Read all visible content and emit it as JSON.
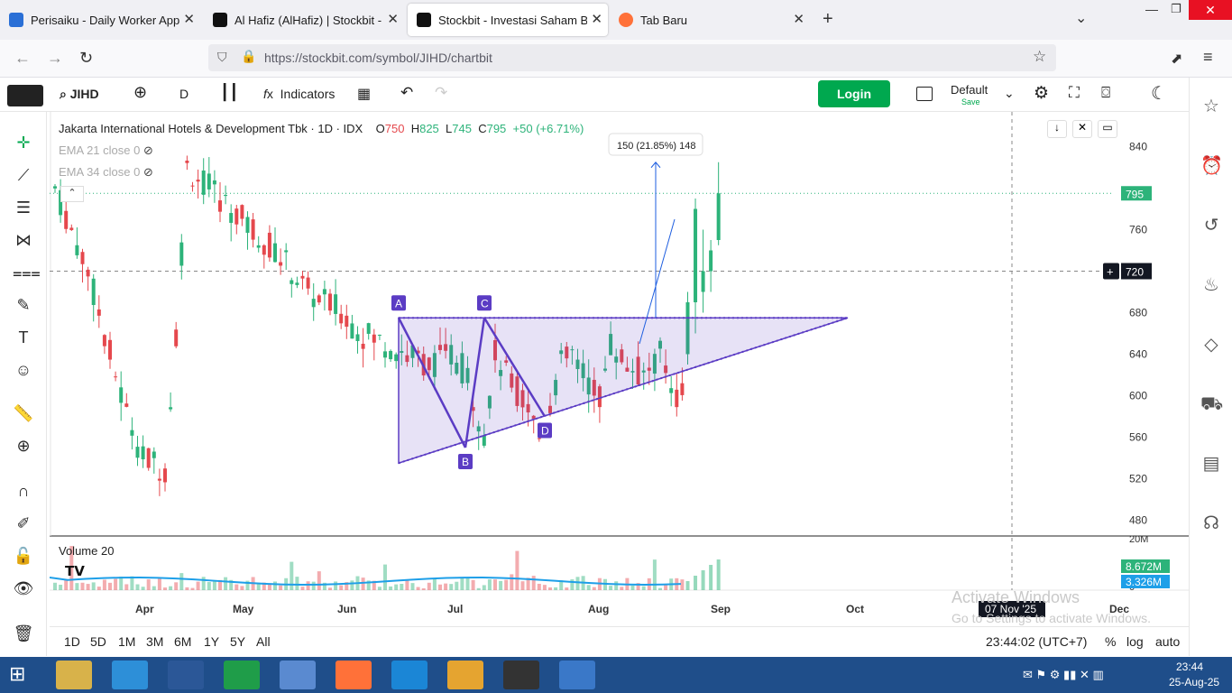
{
  "browser": {
    "tabs": [
      {
        "title": "Perisaiku - Daily Worker App",
        "active": false
      },
      {
        "title": "Al Hafiz (AlHafiz) | Stockbit - Inv",
        "active": false
      },
      {
        "title": "Stockbit - Investasi Saham Bersa",
        "active": true
      },
      {
        "title": "Tab Baru",
        "active": false
      }
    ],
    "new_tab": "+",
    "url": "https://stockbit.com/symbol/JIHD/chartbit"
  },
  "toolbar": {
    "symbol": "JIHD",
    "interval": "D",
    "indicators_label": "Indicators",
    "login_label": "Login",
    "layout_name": "Default",
    "layout_save": "Save"
  },
  "chart": {
    "title": "Jakarta International Hotels & Development Tbk · 1D · IDX",
    "ohlc": {
      "o_label": "O",
      "o": "750",
      "h_label": "H",
      "h": "825",
      "l_label": "L",
      "l": "745",
      "c_label": "C",
      "c": "795",
      "change": "+50 (+6.71%)"
    },
    "ema1": "EMA 21 close 0",
    "ema2": "EMA 34 close 0",
    "volume_label": "Volume 20",
    "measure_label": "150 (21.85%) 148",
    "last_price": "795",
    "crosshair_price": "720",
    "crosshair_date": "07 Nov '25",
    "price_ticks": [
      "840",
      "760",
      "680",
      "640",
      "600",
      "560",
      "520",
      "480"
    ],
    "volume_ticks": [
      "20M",
      "0"
    ],
    "volume_badges": [
      "8.672M",
      "3.326M"
    ],
    "months": [
      "Apr",
      "May",
      "Jun",
      "Jul",
      "Aug",
      "Sep",
      "Oct",
      "Dec"
    ],
    "points": [
      "A",
      "B",
      "C",
      "D"
    ]
  },
  "chart_data": {
    "type": "candlestick",
    "title": "Jakarta International Hotels & Development Tbk · 1D · IDX",
    "ylim": [
      470,
      870
    ],
    "y_ticks": [
      480,
      520,
      560,
      600,
      640,
      680,
      760,
      840
    ],
    "last": {
      "open": 750,
      "high": 825,
      "low": 745,
      "close": 795
    },
    "pattern_points": [
      {
        "label": "A",
        "price": 675
      },
      {
        "label": "B",
        "price": 550
      },
      {
        "label": "C",
        "price": 675
      },
      {
        "label": "D",
        "price": 580
      }
    ],
    "up_color": "#2db37a",
    "down_color": "#e5484d"
  },
  "bottom": {
    "ranges": [
      "1D",
      "5D",
      "1M",
      "3M",
      "6M",
      "1Y",
      "5Y",
      "All"
    ],
    "clock": "23:44:02 (UTC+7)",
    "pct": "%",
    "log": "log",
    "auto": "auto"
  },
  "watermark": {
    "line1": "Activate Windows",
    "line2": "Go to Settings to activate Windows."
  },
  "taskbar": {
    "time": "23:44",
    "date": "25-Aug-25"
  },
  "colors": {
    "accent": "#00a84f",
    "up": "#2db37a",
    "down": "#e5484d",
    "pattern": "#5b3cc4"
  }
}
